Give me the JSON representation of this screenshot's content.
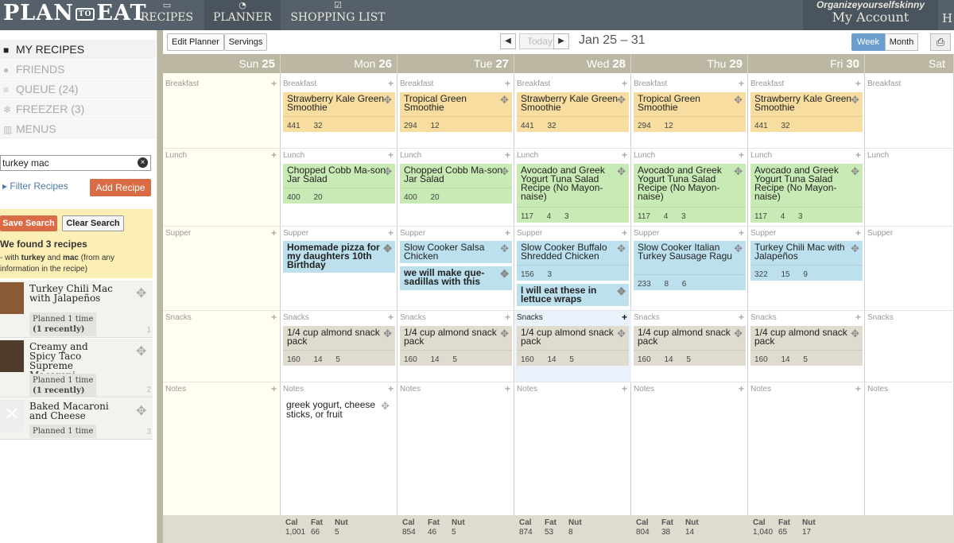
{
  "app": {
    "logo": "PLAN",
    "logo_to": "TO",
    "logo_end": "EAT"
  },
  "nav": [
    {
      "label": "RECIPES",
      "icon": "recipes-icon"
    },
    {
      "label": "PLANNER",
      "icon": "planner-icon"
    },
    {
      "label": "SHOPPING LIST",
      "icon": "checklist-icon"
    }
  ],
  "account": {
    "username": "Organizeyourselfskinny",
    "label": "My Account",
    "extra": "H"
  },
  "sidebar": {
    "items": [
      {
        "label": "MY RECIPES",
        "icon": "book-icon"
      },
      {
        "label": "FRIENDS",
        "icon": "person-icon"
      },
      {
        "label": "QUEUE (24)",
        "icon": "list-icon"
      },
      {
        "label": "FREEZER (3)",
        "icon": "snowflake-icon"
      },
      {
        "label": "MENUS",
        "icon": "menu-book-icon"
      }
    ],
    "search_value": "turkey mac",
    "filter_label": "Filter Recipes",
    "add_recipe": "Add Recipe",
    "save_search": "Save Search",
    "clear_search": "Clear Search",
    "found": "We found 3 recipes",
    "found_sub_1": "with ",
    "found_kw1": "turkey",
    "found_and": " and ",
    "found_kw2": "mac",
    "found_sub_2": " (from any information in the recipe)",
    "recipes": [
      {
        "title": "Turkey Chili Mac with Jalapeños",
        "planned": "Planned 1 time",
        "recent": "(1 recently)",
        "num": "1"
      },
      {
        "title": "Creamy and Spicy Taco Supreme Macaroni",
        "planned": "Planned 1 time",
        "recent": "(1 recently)",
        "num": "2"
      },
      {
        "title": "Baked Macaroni and Cheese",
        "planned": "Planned 1 time",
        "recent": "",
        "num": "3"
      }
    ]
  },
  "toolbar": {
    "edit_planner": "Edit Planner",
    "servings": "Servings",
    "today": "Today",
    "range": "Jan 25 – 31",
    "week": "Week",
    "month": "Month"
  },
  "days": [
    {
      "name": "Sun",
      "num": "25"
    },
    {
      "name": "Mon",
      "num": "26"
    },
    {
      "name": "Tue",
      "num": "27"
    },
    {
      "name": "Wed",
      "num": "28"
    },
    {
      "name": "Thu",
      "num": "29"
    },
    {
      "name": "Fri",
      "num": "30"
    },
    {
      "name": "Sat",
      "num": ""
    }
  ],
  "meal_labels": {
    "breakfast": "Breakfast",
    "lunch": "Lunch",
    "supper": "Supper",
    "snacks": "Snacks",
    "notes": "Notes"
  },
  "meals": {
    "mon": {
      "breakfast": {
        "name": "Strawberry Kale Green Smoothie",
        "nut": "441 32"
      },
      "lunch": {
        "name": "Chopped Cobb Ma-son Jar Salad",
        "nut": "400 20"
      },
      "supper": {
        "name": "Homemade pizza for my daughters 10th Birthday"
      },
      "snacks": {
        "name": "1/4 cup almond snack pack",
        "nut": "160 14 5"
      },
      "notes": "greek yogurt, cheese sticks, or fruit"
    },
    "tue": {
      "breakfast": {
        "name": "Tropical Green Smoothie",
        "nut": "294 12"
      },
      "lunch": {
        "name": "Chopped Cobb Ma-son Jar Salad",
        "nut": "400 20"
      },
      "supper": {
        "name": "Slow Cooker Salsa Chicken"
      },
      "supper2": {
        "name": "we will make que-sadillas with this"
      },
      "snacks": {
        "name": "1/4 cup almond snack pack",
        "nut": "160 14 5"
      }
    },
    "wed": {
      "breakfast": {
        "name": "Strawberry Kale Green Smoothie",
        "nut": "441 32"
      },
      "lunch": {
        "name": "Avocado and Greek Yogurt Tuna Salad Recipe (No Mayon-naise)",
        "nut": "117 4 3"
      },
      "supper": {
        "name": "Slow Cooker Buffalo Shredded Chicken",
        "nut": "156 3"
      },
      "supper2": {
        "name": "I will eat these in lettuce wraps"
      },
      "snacks": {
        "name": "1/4 cup almond snack pack",
        "nut": "160 14 5"
      }
    },
    "thu": {
      "breakfast": {
        "name": "Tropical Green Smoothie",
        "nut": "294 12"
      },
      "lunch": {
        "name": "Avocado and Greek Yogurt Tuna Salad Recipe (No Mayon-naise)",
        "nut": "117 4 3"
      },
      "supper": {
        "name": "Slow Cooker Italian Turkey Sausage Ragu",
        "nut": "233 8 6"
      },
      "snacks": {
        "name": "1/4 cup almond snack pack",
        "nut": "160 14 5"
      }
    },
    "fri": {
      "breakfast": {
        "name": "Strawberry Kale Green Smoothie",
        "nut": "441 32"
      },
      "lunch": {
        "name": "Avocado and Greek Yogurt Tuna Salad Recipe (No Mayon-naise)",
        "nut": "117 4 3"
      },
      "supper": {
        "name": "Turkey Chili Mac with Jalapeños",
        "nut": "322 15 9"
      },
      "snacks": {
        "name": "1/4 cup almond snack pack",
        "nut": "160 14 5"
      }
    }
  },
  "totals_headers": {
    "cal": "Cal",
    "fat": "Fat",
    "nut": "Nut"
  },
  "totals": {
    "mon": {
      "cal": "1,001",
      "fat": "66",
      "nut": "5"
    },
    "tue": {
      "cal": "854",
      "fat": "46",
      "nut": "5"
    },
    "wed": {
      "cal": "874",
      "fat": "53",
      "nut": "8"
    },
    "thu": {
      "cal": "804",
      "fat": "38",
      "nut": "14"
    },
    "fri": {
      "cal": "1,040",
      "fat": "65",
      "nut": "17"
    }
  }
}
